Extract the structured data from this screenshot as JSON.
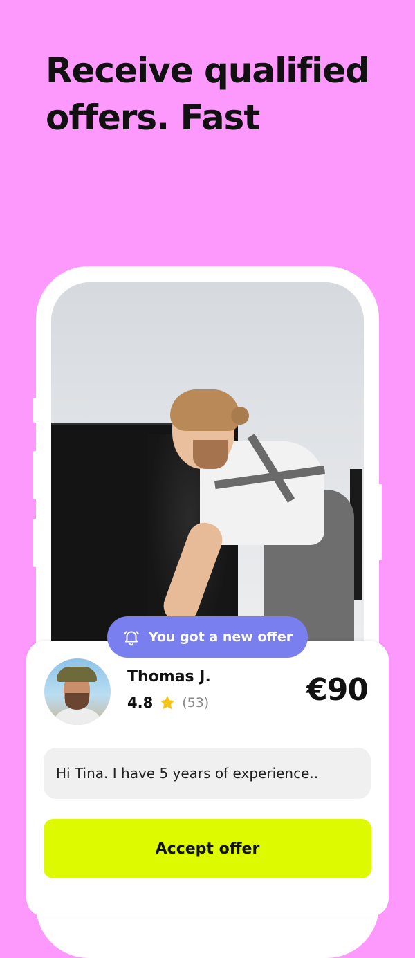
{
  "headline": {
    "line1": "Receive qualified",
    "line2": "offers. Fast"
  },
  "notification": {
    "icon": "bell-icon",
    "text": "You got a new offer"
  },
  "offer": {
    "name": "Thomas J.",
    "rating": "4.8",
    "rating_icon": "star-icon",
    "review_count": "(53)",
    "price": "€90",
    "message": "Hi Tina. I have 5 years of experience..",
    "accept_label": "Accept offer"
  },
  "colors": {
    "background": "#FD99FD",
    "notification": "#7A7FF0",
    "accept_button": "#DDFA00",
    "star": "#F5C518"
  }
}
